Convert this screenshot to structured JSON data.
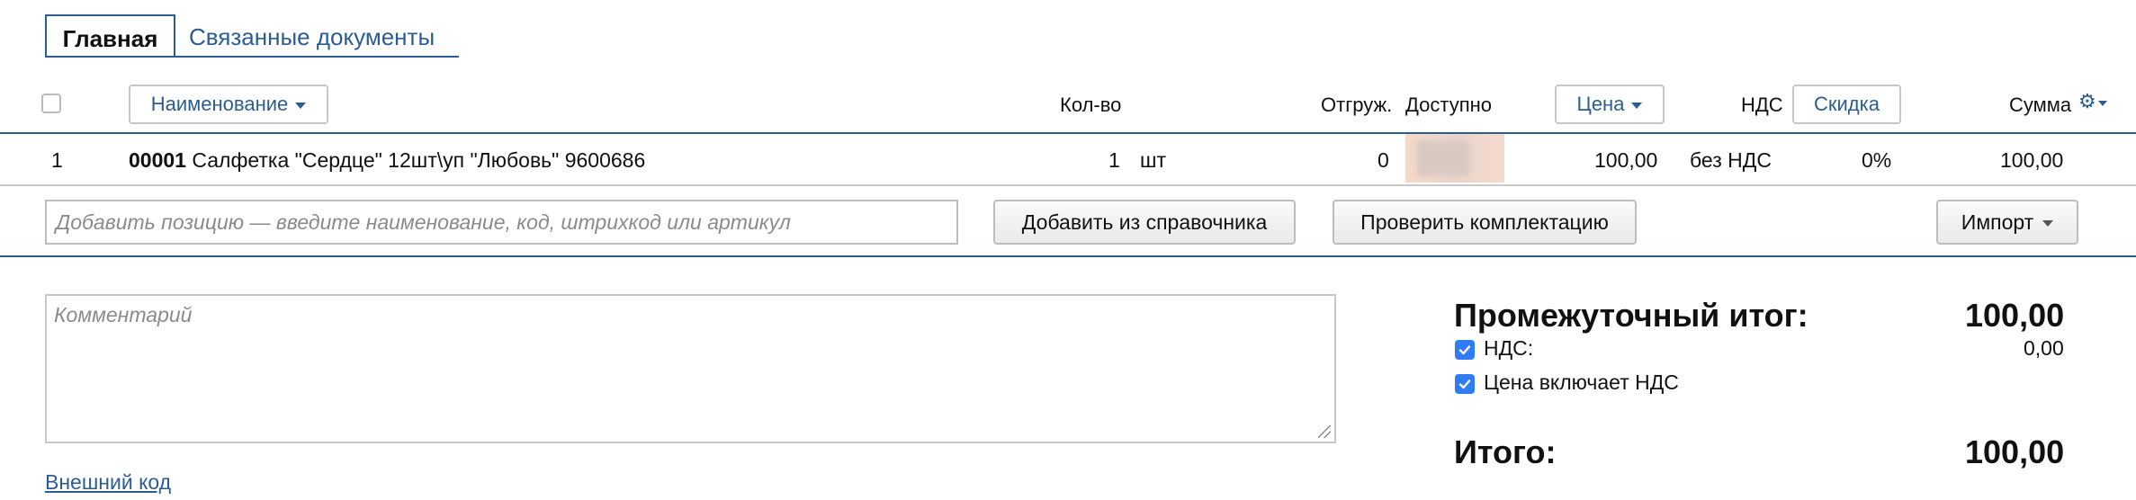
{
  "tabs": [
    {
      "label": "Главная",
      "active": true
    },
    {
      "label": "Связанные документы",
      "active": false
    }
  ],
  "columns": {
    "name_btn": "Наименование",
    "qty": "Кол-во",
    "shipped": "Отгруж.",
    "available": "Доступно",
    "price_btn": "Цена",
    "vat": "НДС",
    "discount_btn": "Скидка",
    "sum": "Сумма"
  },
  "rows": [
    {
      "index": "1",
      "code": "00001",
      "name": "Салфетка \"Сердце\" 12шт\\уп \"Любовь\" 9600686",
      "qty": "1",
      "unit": "шт",
      "shipped": "0",
      "price": "100,00",
      "vat": "без НДС",
      "discount": "0%",
      "sum": "100,00"
    }
  ],
  "add_row": {
    "placeholder": "Добавить позицию — введите наименование, код, штрихкод или артикул",
    "add_from_catalog": "Добавить из справочника",
    "check_kit": "Проверить комплектацию",
    "import": "Импорт"
  },
  "comment": {
    "placeholder": "Комментарий"
  },
  "external_code_link": "Внешний код",
  "totals": {
    "subtotal_label": "Промежуточный итог:",
    "subtotal_value": "100,00",
    "vat_label": "НДС:",
    "vat_value": "0,00",
    "vat_checked": true,
    "price_includes_vat_label": "Цена включает НДС",
    "price_includes_vat_checked": true,
    "total_label": "Итого:",
    "total_value": "100,00"
  },
  "colors": {
    "accent": "#2c5d92",
    "checkbox": "#2f7cf6"
  },
  "icons": [
    "gear-icon",
    "chevron-down-icon",
    "checkmark-icon",
    "resize-grip-icon"
  ]
}
